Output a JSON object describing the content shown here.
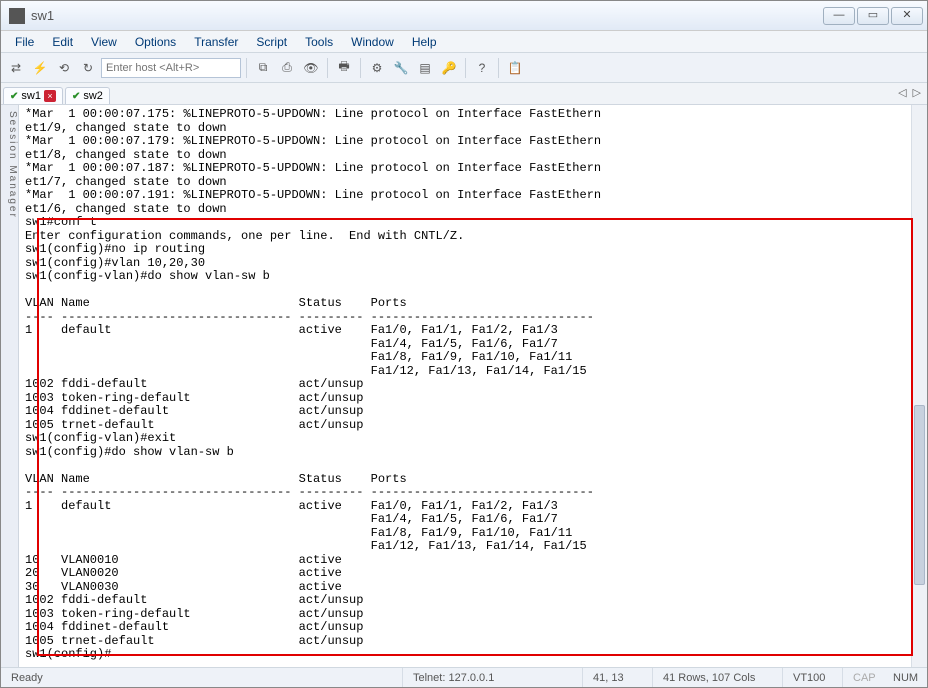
{
  "window": {
    "title": "sw1",
    "minimize": "—",
    "maximize": "▭",
    "close": "✕"
  },
  "menu": [
    "File",
    "Edit",
    "View",
    "Options",
    "Transfer",
    "Script",
    "Tools",
    "Window",
    "Help"
  ],
  "toolbar": {
    "host_placeholder": "Enter host <Alt+R>",
    "icons": [
      "reconnect",
      "flash",
      "loop",
      "refresh",
      "copy",
      "paste",
      "find",
      "print",
      "gear",
      "wrench",
      "cascade",
      "key",
      "help",
      "tips"
    ]
  },
  "tabs": [
    {
      "label": "sw1",
      "active": true,
      "closable": true
    },
    {
      "label": "sw2",
      "active": false,
      "closable": false
    }
  ],
  "tabnav": {
    "left": "◁",
    "right": "▷"
  },
  "sidebar_label": "Session Manager",
  "terminal_lines": [
    "*Mar  1 00:00:07.175: %LINEPROTO-5-UPDOWN: Line protocol on Interface FastEthern",
    "et1/9, changed state to down",
    "*Mar  1 00:00:07.179: %LINEPROTO-5-UPDOWN: Line protocol on Interface FastEthern",
    "et1/8, changed state to down",
    "*Mar  1 00:00:07.187: %LINEPROTO-5-UPDOWN: Line protocol on Interface FastEthern",
    "et1/7, changed state to down",
    "*Mar  1 00:00:07.191: %LINEPROTO-5-UPDOWN: Line protocol on Interface FastEthern",
    "et1/6, changed state to down",
    "sw1#conf t",
    "Enter configuration commands, one per line.  End with CNTL/Z.",
    "sw1(config)#no ip routing",
    "sw1(config)#vlan 10,20,30",
    "sw1(config-vlan)#do show vlan-sw b",
    "",
    "VLAN Name                             Status    Ports",
    "---- -------------------------------- --------- -------------------------------",
    "1    default                          active    Fa1/0, Fa1/1, Fa1/2, Fa1/3",
    "                                                Fa1/4, Fa1/5, Fa1/6, Fa1/7",
    "                                                Fa1/8, Fa1/9, Fa1/10, Fa1/11",
    "                                                Fa1/12, Fa1/13, Fa1/14, Fa1/15",
    "1002 fddi-default                     act/unsup",
    "1003 token-ring-default               act/unsup",
    "1004 fddinet-default                  act/unsup",
    "1005 trnet-default                    act/unsup",
    "sw1(config-vlan)#exit",
    "sw1(config)#do show vlan-sw b",
    "",
    "VLAN Name                             Status    Ports",
    "---- -------------------------------- --------- -------------------------------",
    "1    default                          active    Fa1/0, Fa1/1, Fa1/2, Fa1/3",
    "                                                Fa1/4, Fa1/5, Fa1/6, Fa1/7",
    "                                                Fa1/8, Fa1/9, Fa1/10, Fa1/11",
    "                                                Fa1/12, Fa1/13, Fa1/14, Fa1/15",
    "10   VLAN0010                         active",
    "20   VLAN0020                         active",
    "30   VLAN0030                         active",
    "1002 fddi-default                     act/unsup",
    "1003 token-ring-default               act/unsup",
    "1004 fddinet-default                  act/unsup",
    "1005 trnet-default                    act/unsup",
    "sw1(config)#"
  ],
  "status": {
    "ready": "Ready",
    "conn": "Telnet: 127.0.0.1",
    "cursor": "41,  13",
    "size": "41 Rows, 107 Cols",
    "emu": "VT100",
    "cap": "CAP",
    "num": "NUM"
  }
}
